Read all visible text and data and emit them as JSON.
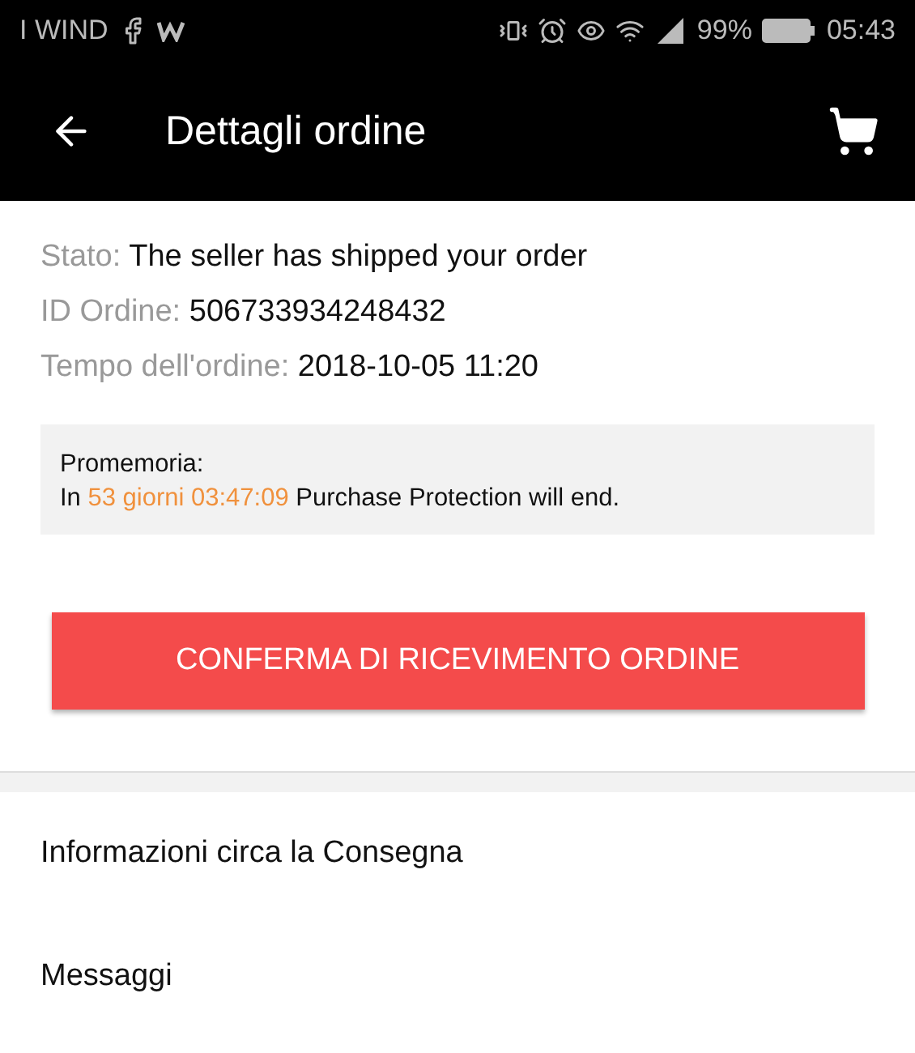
{
  "status_bar": {
    "carrier": "I WIND",
    "battery": "99%",
    "time": "05:43"
  },
  "toolbar": {
    "title": "Dettagli ordine"
  },
  "details": [
    {
      "label": "Stato:",
      "value": "The seller has shipped your order"
    },
    {
      "label": "ID Ordine:",
      "value": "506733934248432"
    },
    {
      "label": "Tempo dell'ordine:",
      "value": "2018-10-05 11:20"
    }
  ],
  "reminder": {
    "title": "Promemoria:",
    "parts": [
      {
        "kind": "plain",
        "text": "In "
      },
      {
        "kind": "highlight",
        "text": "53 giorni 03:47:09"
      },
      {
        "kind": "plain",
        "text": " Purchase Protection will end."
      }
    ]
  },
  "confirm_button": "CONFERMA DI RICEVIMENTO ORDINE",
  "menu": [
    {
      "label": "Informazioni circa la Consegna"
    },
    {
      "label": "Messaggi"
    }
  ]
}
